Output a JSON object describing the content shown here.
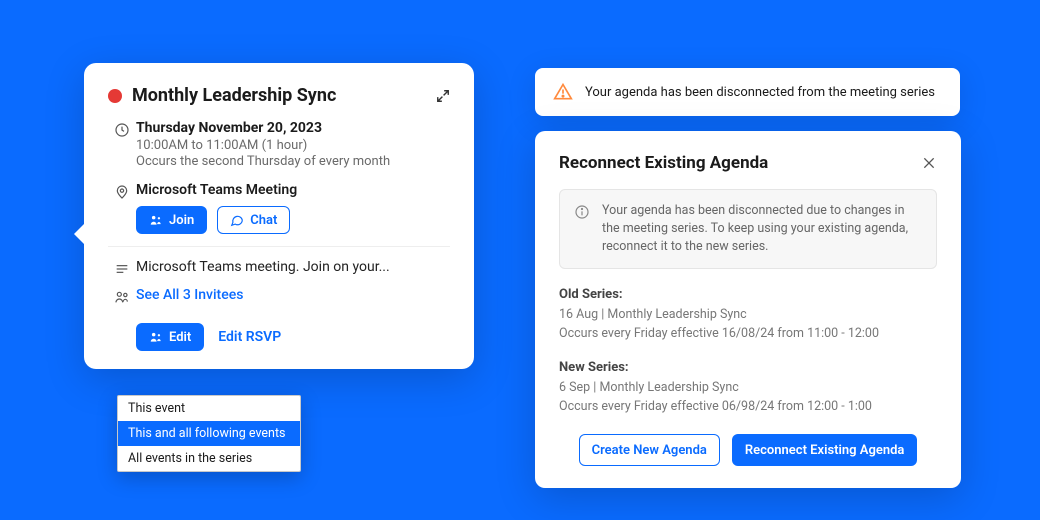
{
  "event": {
    "title": "Monthly Leadership Sync",
    "date_line": "Thursday November 20, 2023",
    "time_line": "10:00AM to 11:00AM (1 hour)",
    "recurrence": "Occurs the second Thursday of every month",
    "location": "Microsoft Teams Meeting",
    "join_label": "Join",
    "chat_label": "Chat",
    "body_preview": "Microsoft Teams meeting. Join on your...",
    "invitees_link": "See All 3 Invitees",
    "edit_label": "Edit",
    "edit_rsvp_label": "Edit RSVP",
    "edit_menu": {
      "opt1": "This event",
      "opt2": "This and all following events",
      "opt3": "All events in the series"
    }
  },
  "banner": {
    "text": "Your agenda has been disconnected from the meeting series"
  },
  "modal": {
    "title": "Reconnect Existing Agenda",
    "info": "Your agenda has been disconnected due to changes in the meeting series. To keep using your existing agenda, reconnect it to the new series.",
    "old": {
      "label": "Old Series:",
      "title": "16 Aug | Monthly Leadership Sync",
      "recurrence": "Occurs every Friday effective 16/08/24 from 11:00 - 12:00"
    },
    "new": {
      "label": "New Series:",
      "title": "6 Sep | Monthly Leadership Sync",
      "recurrence": "Occurs every Friday effective 06/98/24 from 12:00 - 1:00"
    },
    "create_label": "Create New Agenda",
    "reconnect_label": "Reconnect Existing Agenda"
  }
}
